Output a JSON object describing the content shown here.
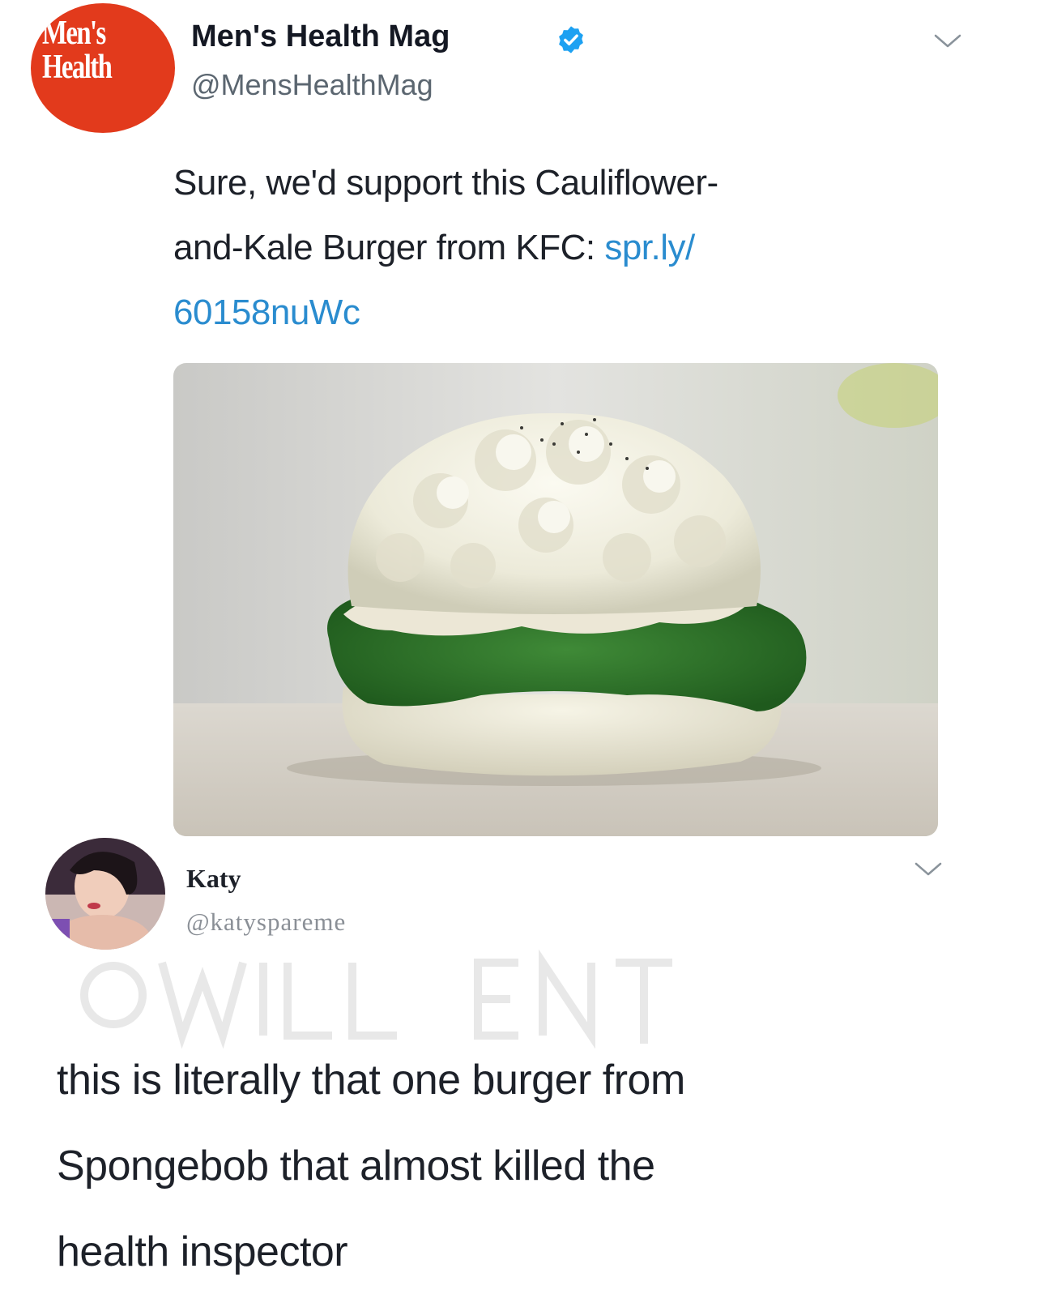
{
  "tweet1": {
    "avatar_logo_line1": "Men's",
    "avatar_logo_line2": "Health",
    "display_name": "Men's Health Mag",
    "handle": "@MensHealthMag",
    "text_line1": "Sure, we'd support this Cauliflower-",
    "text_line2_plain": "and-Kale Burger from KFC: ",
    "text_line2_link": "spr.ly/",
    "text_line3_link": "60158nuWc",
    "verified_badge_icon": "verified-badge-icon",
    "menu_icon": "chevron-down-icon"
  },
  "tweet2": {
    "display_name": "Katy",
    "handle": "@katyspareme",
    "text_line1": "this is literally that one burger from",
    "text_line2": "Spongebob that almost killed the",
    "text_line3": "health inspector",
    "menu_icon": "chevron-down-icon"
  },
  "colors": {
    "brand_red": "#e23a1c",
    "link_blue": "#2a8ccf",
    "verified_blue": "#1da1f2",
    "handle_gray": "#5b6670"
  }
}
